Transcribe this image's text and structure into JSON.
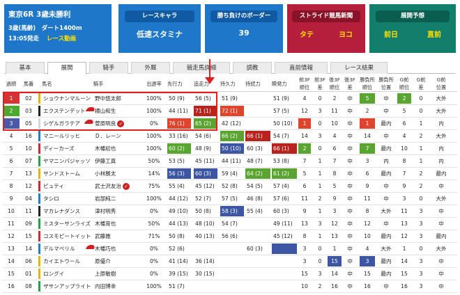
{
  "race": {
    "title": "東京6R 3歳未勝利",
    "course": "3歳(馬齢)　ダート1400m",
    "time": "13:05発走",
    "video": "レース動画"
  },
  "cards": {
    "character": {
      "label": "レースキャラ",
      "value": "低速スタミナ"
    },
    "border": {
      "label": "勝ち負けのボーダー",
      "value": "39"
    },
    "stride": {
      "label": "ストライド競馬新聞",
      "left": "タテ",
      "right": "ヨコ"
    },
    "forecast": {
      "label": "展開予想",
      "left": "前日",
      "right": "直前"
    }
  },
  "tabs": [
    "基本",
    "展開",
    "騎手",
    "外厩",
    "競走馬詳細",
    "調教",
    "直前情報",
    "レース結果"
  ],
  "active_tab": "展開",
  "headers": [
    "過順",
    "馬番",
    "馬名",
    "騎手",
    "出遅率",
    "先行力",
    "追走力",
    "持久力",
    "持続力",
    "瞬発力",
    "前3F\n順位",
    "前3F\n差",
    "後3F\n順位",
    "後3F\n差",
    "勝負所\n順位",
    "勝負所\n位置",
    "G前\n順位",
    "G前\n差",
    "G前\n位置"
  ],
  "rows": [
    {
      "rank": "1",
      "num": "02",
      "name": "ショウナンマルーン",
      "jockey": "野中悠太郎",
      "late": "100%",
      "senko": "50 (9)",
      "tsuiso": "56 (5)",
      "jikyu": "51 (9)",
      "jizoku": "",
      "shunpatsu": "51 (9)",
      "f3r": "4",
      "f3d": "0",
      "l3r": "2",
      "l3d": "中",
      "shr": "5",
      "shp": "中",
      "gr": "2",
      "gd": "0",
      "gp": "大外"
    },
    {
      "rank": "2",
      "num": "03",
      "name": "エクステンデット",
      "jockey": "横山和生",
      "late": "100%",
      "senko": "44 (11)",
      "tsuiso": "71 (1)",
      "jikyu": "72 (1)",
      "jizoku": "",
      "shunpatsu": "57 (5)",
      "f3r": "12",
      "f3d": "3",
      "l3r": "11",
      "l3d": "中",
      "shr": "2",
      "shp": "中",
      "gr": "5",
      "gd": "0",
      "gp": "大外"
    },
    {
      "rank": "3",
      "num": "05",
      "name": "シゲルガラテア",
      "jockey": "菅原明良",
      "late": "0%",
      "senko": "76 (1)",
      "tsuiso": "65 (2)",
      "jikyu": "42 (12)",
      "jizoku": "",
      "shunpatsu": "50 (10)",
      "f3r": "1",
      "f3d": "0",
      "l3r": "10",
      "l3d": "中",
      "shr": "1",
      "shp": "最内",
      "gr": "6",
      "gd": "1",
      "gp": "内"
    },
    {
      "rank": "4",
      "num": "16",
      "name": "マニールリッヒ",
      "jockey": "Ｄ．レーン",
      "late": "100%",
      "senko": "33 (16)",
      "tsuiso": "54 (6)",
      "jikyu": "66 (2)",
      "jizoku": "66 (1)",
      "shunpatsu": "54 (7)",
      "f3r": "14",
      "f3d": "3",
      "l3r": "4",
      "l3d": "中",
      "shr": "14",
      "shp": "中",
      "gr": "4",
      "gd": "2",
      "gp": "大外"
    },
    {
      "rank": "5",
      "num": "10",
      "name": "ディーカーズ",
      "jockey": "木幡初也",
      "late": "100%",
      "senko": "60 (2)",
      "tsuiso": "48 (9)",
      "jikyu": "50 (10)",
      "jizoku": "60 (3)",
      "shunpatsu": "66 (1)",
      "f3r": "2",
      "f3d": "0",
      "l3r": "6",
      "l3d": "中",
      "shr": "7",
      "shp": "最内",
      "gr": "10",
      "gd": "1",
      "gp": "内"
    },
    {
      "rank": "6",
      "num": "07",
      "name": "ヤマニンパジャッソ",
      "jockey": "伊藤工真",
      "late": "50%",
      "senko": "53 (5)",
      "tsuiso": "45 (11)",
      "jikyu": "44 (11)",
      "jizoku": "48 (7)",
      "shunpatsu": "53 (8)",
      "f3r": "7",
      "f3d": "1",
      "l3r": "7",
      "l3d": "中",
      "shr": "3",
      "shp": "内",
      "gr": "8",
      "gd": "1",
      "gp": "内"
    },
    {
      "rank": "7",
      "num": "13",
      "name": "サンドストーム",
      "jockey": "小林勝太",
      "late": "14%",
      "senko": "56 (3)",
      "tsuiso": "60 (3)",
      "jikyu": "59 (4)",
      "jizoku": "64 (2)",
      "shunpatsu": "61 (2)",
      "f3r": "5",
      "f3d": "1",
      "l3r": "8",
      "l3d": "中",
      "shr": "6",
      "shp": "最内",
      "gr": "7",
      "gd": "2",
      "gp": "最内"
    },
    {
      "rank": "8",
      "num": "12",
      "name": "ピュティ",
      "jockey": "武士沢友治",
      "late": "75%",
      "senko": "55 (4)",
      "tsuiso": "45 (12)",
      "jikyu": "52 (8)",
      "jizoku": "54 (5)",
      "shunpatsu": "57 (4)",
      "f3r": "6",
      "f3d": "1",
      "l3r": "5",
      "l3d": "中",
      "shr": "9",
      "shp": "中",
      "gr": "9",
      "gd": "2",
      "gp": "中"
    },
    {
      "rank": "9",
      "num": "04",
      "name": "タシロ",
      "jockey": "岩部純二",
      "late": "100%",
      "senko": "44 (12)",
      "tsuiso": "52 (7)",
      "jikyu": "57 (5)",
      "jizoku": "46 (8)",
      "shunpatsu": "57 (6)",
      "f3r": "11",
      "f3d": "2",
      "l3r": "9",
      "l3d": "中",
      "shr": "11",
      "shp": "中",
      "gr": "3",
      "gd": "0",
      "gp": "大外"
    },
    {
      "rank": "10",
      "num": "11",
      "name": "マカレナダンス",
      "jockey": "津村明秀",
      "late": "0%",
      "senko": "49 (10)",
      "tsuiso": "50 (8)",
      "jikyu": "58 (3)",
      "jizoku": "55 (4)",
      "shunpatsu": "60 (3)",
      "f3r": "9",
      "f3d": "1",
      "l3r": "3",
      "l3d": "中",
      "shr": "8",
      "shp": "大外",
      "gr": "11",
      "gd": "3",
      "gp": "中"
    },
    {
      "rank": "11",
      "num": "09",
      "name": "ミスターサンライズ",
      "jockey": "木幡育也",
      "late": "50%",
      "senko": "44 (13)",
      "tsuiso": "48 (10)",
      "jikyu": "54 (7)",
      "jizoku": "",
      "shunpatsu": "49 (11)",
      "f3r": "13",
      "f3d": "3",
      "l3r": "12",
      "l3d": "中",
      "shr": "12",
      "shp": "中",
      "gr": "13",
      "gd": "3",
      "gp": "中"
    },
    {
      "rank": "12",
      "num": "15",
      "name": "コスモピートイット",
      "jockey": "武藤雅",
      "late": "71%",
      "senko": "50 (8)",
      "tsuiso": "40 (13)",
      "jikyu": "56 (6)",
      "jizoku": "",
      "shunpatsu": "45 (12)",
      "f3r": "8",
      "f3d": "1",
      "l3r": "13",
      "l3d": "中",
      "shr": "10",
      "shp": "最内",
      "gr": "12",
      "gd": "3",
      "gp": "最内"
    },
    {
      "rank": "13",
      "num": "14",
      "name": "デルマベリル",
      "jockey": "木幡巧也",
      "late": "0%",
      "senko": "52 (6)",
      "tsuiso": "",
      "jikyu": "",
      "jizoku": "60 (3)",
      "shunpatsu": "",
      "f3r": "3",
      "f3d": "0",
      "l3r": "1",
      "l3d": "中",
      "shr": "4",
      "shp": "大外",
      "gr": "1",
      "gd": "0",
      "gp": "大外"
    },
    {
      "rank": "14",
      "num": "06",
      "name": "カイエトウール",
      "jockey": "原優介",
      "late": "0%",
      "senko": "41 (14)",
      "tsuiso": "36 (14)",
      "jikyu": "",
      "jizoku": "",
      "shunpatsu": "",
      "f3r": "3",
      "f3d": "0",
      "l3r": "15",
      "l3d": "中",
      "shr": "3",
      "shp": "最内",
      "gr": "14",
      "gd": "3",
      "gp": "中"
    },
    {
      "rank": "15",
      "num": "01",
      "name": "ロングイ",
      "jockey": "上原敏樹",
      "late": "0%",
      "senko": "39 (15)",
      "tsuiso": "30 (15)",
      "jikyu": "",
      "jizoku": "",
      "shunpatsu": "",
      "f3r": "15",
      "f3d": "3",
      "l3r": "14",
      "l3d": "中",
      "shr": "15",
      "shp": "最内",
      "gr": "15",
      "gd": "3",
      "gp": "中"
    },
    {
      "rank": "16",
      "num": "08",
      "name": "ザサンアップライト",
      "jockey": "内田博幸",
      "late": "100%",
      "senko": "51 (7)",
      "tsuiso": "",
      "jikyu": "",
      "jizoku": "",
      "shunpatsu": "",
      "f3r": "10",
      "f3d": "2",
      "l3r": "16",
      "l3d": "中",
      "shr": "16",
      "shp": "中",
      "gr": "16",
      "gd": "3",
      "gp": "中"
    }
  ],
  "colors": {
    "red": "#e0442c",
    "darkred": "#b8231e",
    "green": "#5aa531",
    "blue": "#3d56a3",
    "rank1": "#d33535",
    "rank2": "#4da832",
    "rank3": "#4b5aa8"
  }
}
